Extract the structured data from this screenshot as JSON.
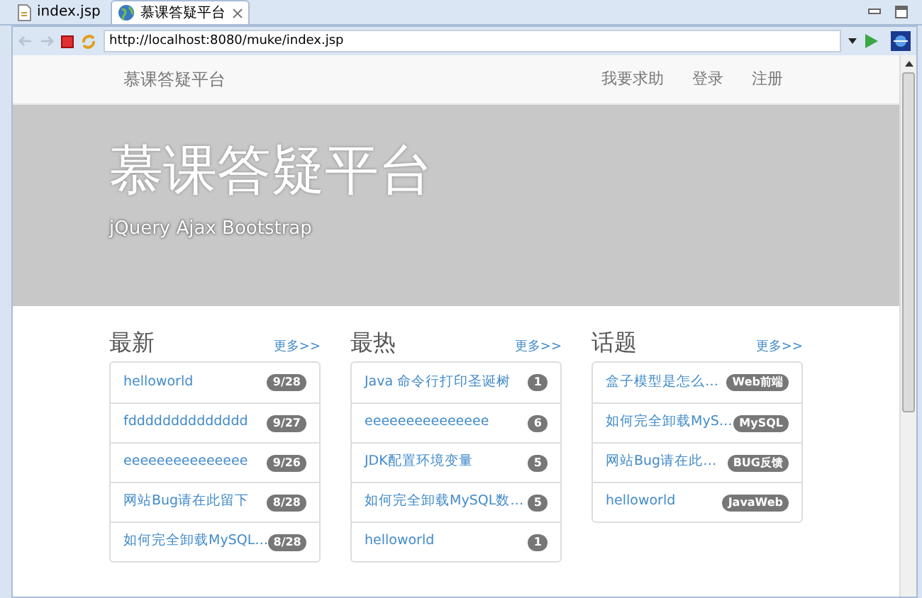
{
  "editor_tabs": [
    {
      "label": "index.jsp",
      "kind": "file",
      "selected": false
    },
    {
      "label": "慕课答疑平台",
      "kind": "web",
      "selected": true
    }
  ],
  "address": {
    "value": "http://localhost:8080/muke/index.jsp"
  },
  "navbar": {
    "brand": "慕课答疑平台",
    "links": [
      "我要求助",
      "登录",
      "注册"
    ]
  },
  "hero": {
    "title": "慕课答疑平台",
    "subtitle": "jQuery Ajax Bootstrap"
  },
  "panels": [
    {
      "heading": "最新",
      "more": "更多>>",
      "items": [
        {
          "title": "helloworld",
          "badge": "9/28"
        },
        {
          "title": "fdddddddddddddd",
          "badge": "9/27"
        },
        {
          "title": "eeeeeeeeeeeeeee",
          "badge": "9/26"
        },
        {
          "title": "网站Bug请在此留下",
          "badge": "8/28"
        },
        {
          "title": "如何完全卸载MySQL…",
          "badge": "8/28"
        }
      ]
    },
    {
      "heading": "最热",
      "more": "更多>>",
      "items": [
        {
          "title": "Java 命令行打印圣诞树",
          "badge": "1"
        },
        {
          "title": "eeeeeeeeeeeeeee",
          "badge": "6"
        },
        {
          "title": "JDK配置环境变量",
          "badge": "5"
        },
        {
          "title": "如何完全卸载MySQL数…",
          "badge": "5"
        },
        {
          "title": "helloworld",
          "badge": "1"
        }
      ]
    },
    {
      "heading": "话题",
      "more": "更多>>",
      "items": [
        {
          "title": "盒子模型是怎么…",
          "badge": "Web前端"
        },
        {
          "title": "如何完全卸载MyS…",
          "badge": "MySQL"
        },
        {
          "title": "网站Bug请在此…",
          "badge": "BUG反馈"
        },
        {
          "title": "helloworld",
          "badge": "JavaWeb"
        }
      ]
    }
  ]
}
